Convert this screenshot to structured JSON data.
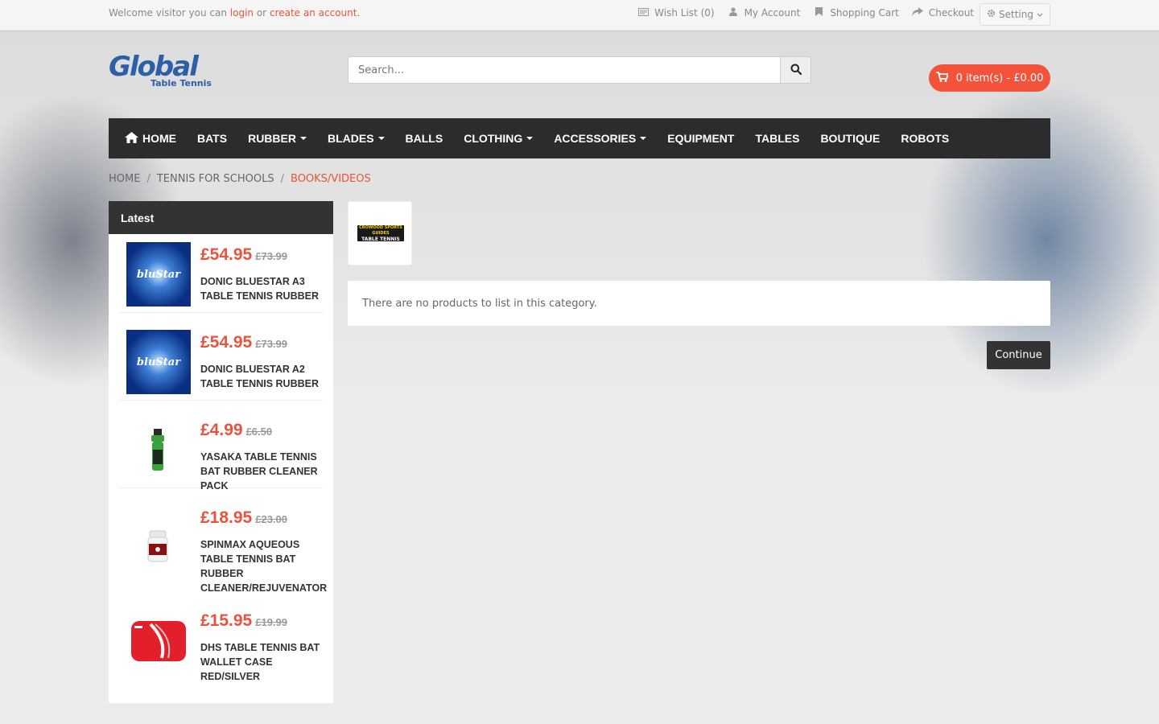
{
  "topbar": {
    "welcome_prefix": "Welcome visitor you can",
    "login_label": "login",
    "or_text": "or",
    "create_account_label": "create an account.",
    "wishlist_label": "Wish List (0)",
    "account_label": "My Account",
    "cart_label": "Shopping Cart",
    "checkout_label": "Checkout",
    "setting_label": "Setting"
  },
  "header": {
    "logo_text": "Global",
    "logo_subtext": "Table Tennis",
    "search_placeholder": "Search...",
    "cart_button": "0 item(s) - £0.00"
  },
  "nav": {
    "items": [
      {
        "label": "HOME",
        "icon": "home-icon",
        "dropdown": false
      },
      {
        "label": "BATS",
        "dropdown": false
      },
      {
        "label": "RUBBER",
        "dropdown": true
      },
      {
        "label": "BLADES",
        "dropdown": true
      },
      {
        "label": "BALLS",
        "dropdown": false
      },
      {
        "label": "CLOTHING",
        "dropdown": true
      },
      {
        "label": "ACCESSORIES",
        "dropdown": true
      },
      {
        "label": "EQUIPMENT",
        "dropdown": false
      },
      {
        "label": "TABLES",
        "dropdown": false
      },
      {
        "label": "BOUTIQUE",
        "dropdown": false
      },
      {
        "label": "ROBOTS",
        "dropdown": false
      }
    ]
  },
  "breadcrumb": {
    "home": "HOME",
    "parent": "TENNIS FOR SCHOOLS",
    "current": "BOOKS/VIDEOS",
    "separator": "/"
  },
  "sidebar": {
    "title": "Latest",
    "products": [
      {
        "price": "£54.95",
        "old_price": "£73.99",
        "name": "DONIC BLUESTAR A3 TABLE TENNIS RUBBER",
        "thumb_text": "bluStar"
      },
      {
        "price": "£54.95",
        "old_price": "£73.99",
        "name": "DONIC BLUESTAR A2 TABLE TENNIS RUBBER",
        "thumb_text": "bluStar"
      },
      {
        "price": "£4.99",
        "old_price": "£6.50",
        "name": "YASAKA TABLE TENNIS BAT RUBBER CLEANER PACK"
      },
      {
        "price": "£18.95",
        "old_price": "£23.00",
        "name": "SPINMAX AQUEOUS TABLE TENNIS BAT RUBBER CLEANER/REJUVENATOR"
      },
      {
        "price": "£15.95",
        "old_price": "£19.99",
        "name": "DHS TABLE TENNIS BAT WALLET CASE RED/SILVER"
      }
    ]
  },
  "content": {
    "category_image_top": "CROWOOD SPORTS GUIDES",
    "category_image_title": "TABLE TENNIS",
    "empty_message": "There are no products to list in this category.",
    "continue_label": "Continue"
  },
  "colors": {
    "accent": "#e8543b",
    "cart_button": "#f4533b",
    "navbar": "#2c2c2c",
    "brand_blue": "#2c5fa8"
  }
}
